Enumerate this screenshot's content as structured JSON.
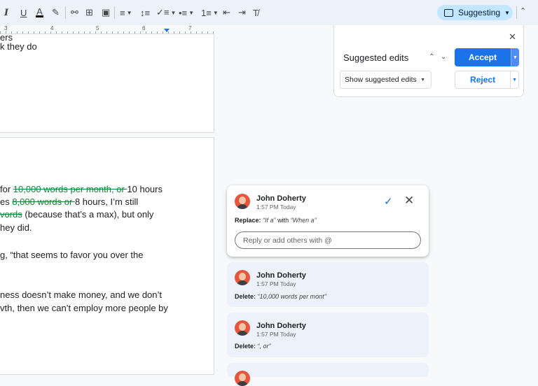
{
  "toolbar": {
    "suggesting_label": "Suggesting"
  },
  "ruler": {
    "numbers": [
      "3",
      "4",
      "5",
      "6",
      "7"
    ]
  },
  "document": {
    "page1_lines": [
      "ers",
      "k they do"
    ],
    "page2": {
      "l1_a": "for ",
      "l1_del": "10,000 words per month, or ",
      "l1_b": "10 hours",
      "l2_a": "es ",
      "l2_del": "8,000 words or ",
      "l2_b": "8 hours, I’m still",
      "l3_del": "vords",
      "l3_b": " (because that’s a max), but only",
      "l4": "hey did.",
      "l5": "g, “that seems to favor you over the",
      "l6": "ness doesn’t make money, and we don’t",
      "l7": "vth, then we can’t employ more people by"
    }
  },
  "suggested_edits_panel": {
    "title": "Suggested edits",
    "accept_label": "Accept",
    "reject_label": "Reject",
    "show_select_value": "Show suggested edits"
  },
  "comments": [
    {
      "author": "John Doherty",
      "time": "1:57 PM Today",
      "action": "Replace:",
      "from": "“If a”",
      "with_word": " with ",
      "to": "“When a”",
      "reply_placeholder": "Reply or add others with @"
    },
    {
      "author": "John Doherty",
      "time": "1:57 PM Today",
      "action": "Delete:",
      "text": "“10,000 words per mont”"
    },
    {
      "author": "John Doherty",
      "time": "1:57 PM Today",
      "action": "Delete:",
      "text": "“, or”"
    }
  ],
  "colors": {
    "accent": "#1a73e8",
    "deleted_text": "#188038",
    "suggesting_pill": "#c2e7ff",
    "card_bg": "#edf2fa"
  }
}
